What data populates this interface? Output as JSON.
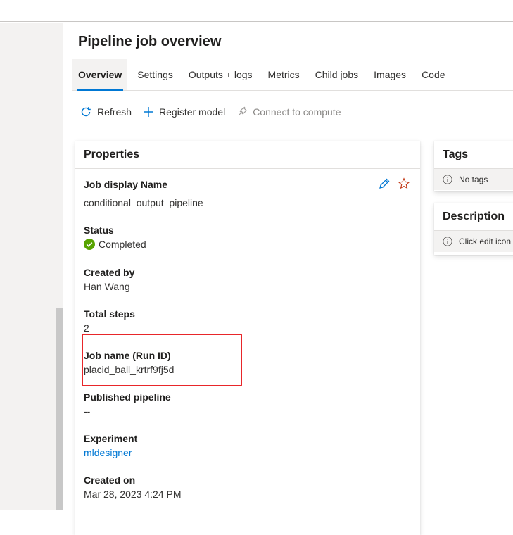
{
  "page": {
    "title": "Pipeline job overview"
  },
  "tabs": [
    {
      "label": "Overview",
      "active": true
    },
    {
      "label": "Settings"
    },
    {
      "label": "Outputs + logs"
    },
    {
      "label": "Metrics"
    },
    {
      "label": "Child jobs"
    },
    {
      "label": "Images"
    },
    {
      "label": "Code"
    }
  ],
  "toolbar": {
    "refresh_label": "Refresh",
    "register_model_label": "Register model",
    "connect_compute_label": "Connect to compute"
  },
  "properties": {
    "title": "Properties",
    "job_display_name_label": "Job display Name",
    "job_display_name_value": "conditional_output_pipeline",
    "status_label": "Status",
    "status_value": "Completed",
    "created_by_label": "Created by",
    "created_by_value": "Han Wang",
    "total_steps_label": "Total steps",
    "total_steps_value": "2",
    "job_name_label": "Job name (Run ID)",
    "job_name_value": "placid_ball_krtrf9fj5d",
    "published_pipeline_label": "Published pipeline",
    "published_pipeline_value": "--",
    "experiment_label": "Experiment",
    "experiment_value": "mldesigner",
    "created_on_label": "Created on",
    "created_on_value": "Mar 28, 2023 4:24 PM"
  },
  "tags": {
    "title": "Tags",
    "empty_text": "No tags"
  },
  "description": {
    "title": "Description",
    "empty_text": "Click edit icon"
  },
  "colors": {
    "accent": "#0078d4",
    "success": "#57a300",
    "favorite": "#c43e1c",
    "highlight": "#e8262a"
  },
  "icons": [
    "refresh-icon",
    "add-icon",
    "plug-icon",
    "status-check-icon",
    "edit-icon",
    "star-icon",
    "info-icon"
  ]
}
